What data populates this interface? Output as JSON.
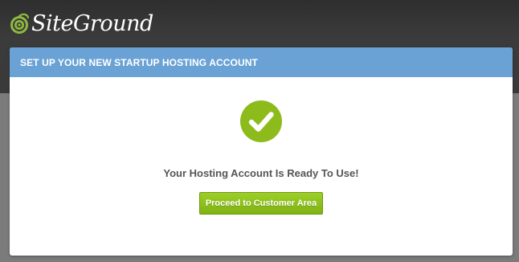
{
  "brand": {
    "name": "SiteGround",
    "logo_icon": "siteground-swirl-icon",
    "logo_color": "#8fb93e"
  },
  "panel": {
    "title": "SET UP YOUR NEW STARTUP HOSTING ACCOUNT",
    "header_color": "#6aa2d6",
    "status_icon": "checkmark-circle-icon",
    "status_color": "#8dbb1b",
    "message": "Your Hosting Account Is Ready To Use!",
    "proceed_label": "Proceed to Customer Area"
  }
}
